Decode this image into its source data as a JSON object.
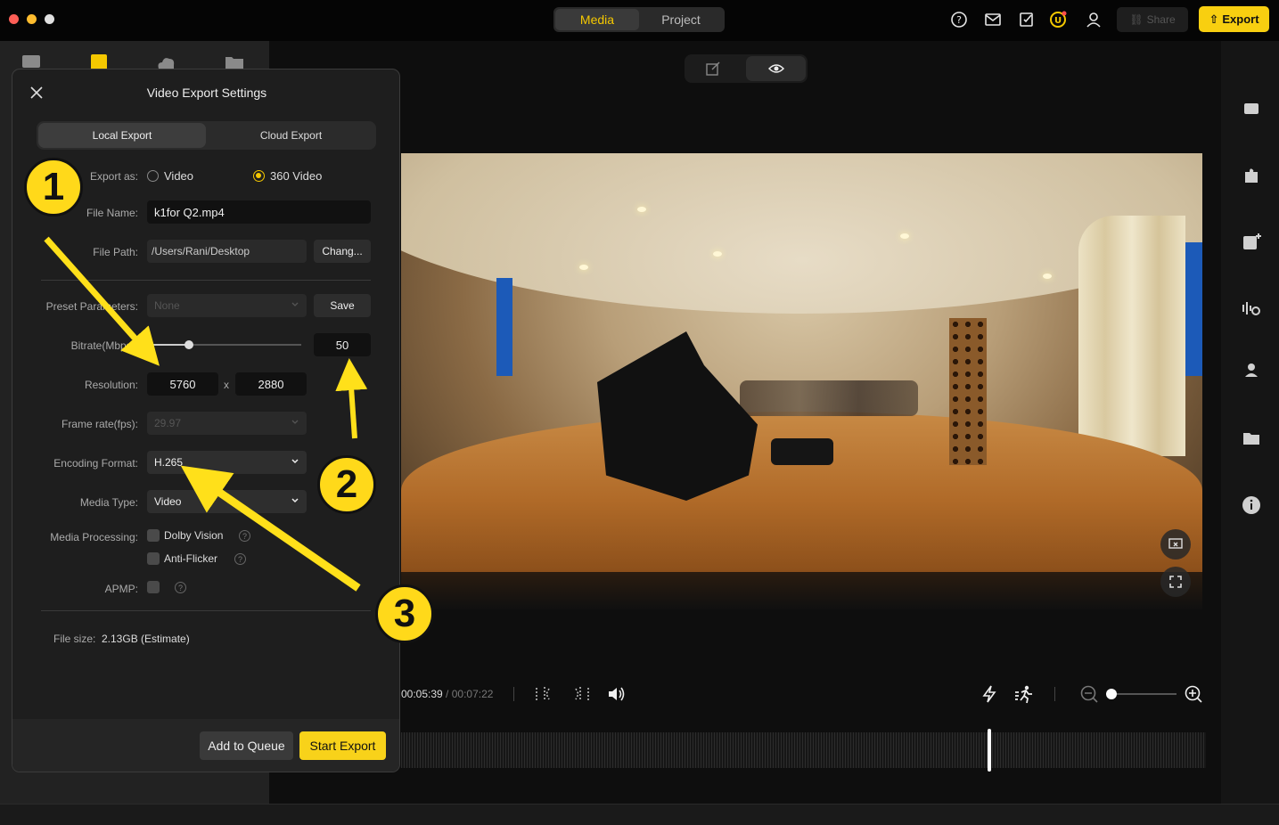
{
  "topbar": {
    "tabs": [
      {
        "label": "Media",
        "active": true
      },
      {
        "label": "Project",
        "active": false
      }
    ],
    "share_label": "Share",
    "export_label": "Export",
    "accent": "#f8cf10"
  },
  "dialog": {
    "title": "Video Export Settings",
    "tabs": {
      "local": "Local Export",
      "cloud": "Cloud Export"
    },
    "export_as": {
      "label": "Export as:",
      "options": [
        "Video",
        "360 Video"
      ],
      "selected": "360 Video"
    },
    "file_name": {
      "label": "File Name:",
      "value": "k1for Q2.mp4"
    },
    "file_path": {
      "label": "File Path:",
      "value": "/Users/Rani/Desktop",
      "change_label": "Chang..."
    },
    "preset": {
      "label": "Preset Parameters:",
      "value": "None",
      "save_label": "Save"
    },
    "bitrate": {
      "label": "Bitrate(Mbps):",
      "value": "50",
      "fraction": 0.25
    },
    "resolution": {
      "label": "Resolution:",
      "width": "5760",
      "separator": "x",
      "height": "2880"
    },
    "frame_rate": {
      "label": "Frame rate(fps):",
      "value": "29.97"
    },
    "encoding": {
      "label": "Encoding Format:",
      "value": "H.265"
    },
    "media_type": {
      "label": "Media Type:",
      "value": "Video"
    },
    "media_processing": {
      "label": "Media Processing:",
      "options": [
        "Dolby Vision",
        "Anti-Flicker"
      ]
    },
    "apmp": {
      "label": "APMP:"
    },
    "file_size": {
      "label": "File size:",
      "value": "2.13GB (Estimate)"
    },
    "footer": {
      "queue_label": "Add to Queue",
      "start_label": "Start Export"
    }
  },
  "playback": {
    "current": "00:05:39",
    "separator": " / ",
    "total": "00:07:22"
  },
  "annotations": [
    "1",
    "2",
    "3"
  ]
}
